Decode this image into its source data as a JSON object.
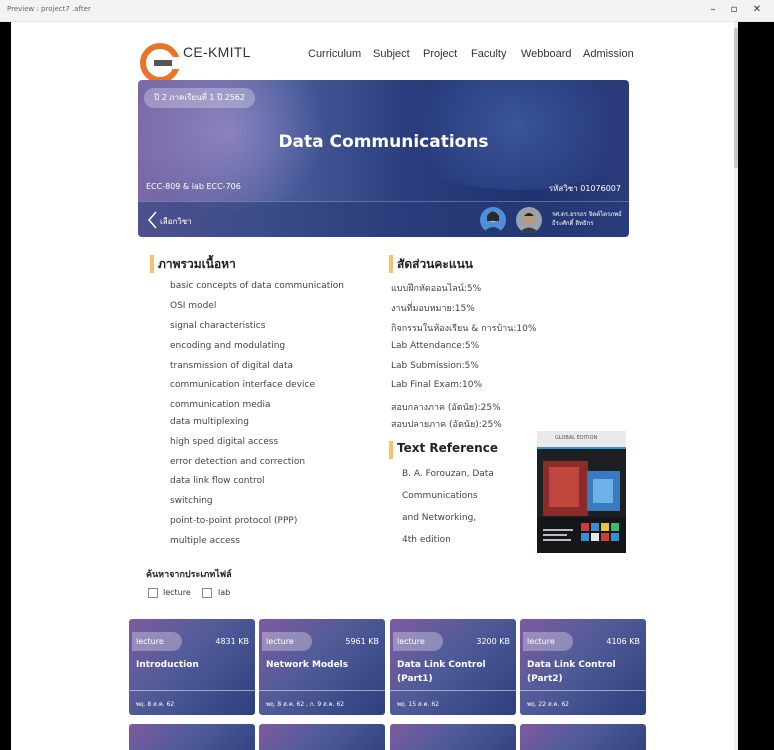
{
  "window": {
    "title": "Preview : project7 .after"
  },
  "nav": {
    "brand": "CE-KMITL",
    "links": [
      "Curriculum",
      "Subject",
      "Project",
      "Faculty",
      "Webboard",
      "Admission"
    ]
  },
  "banner": {
    "term": "ปี 2 ภาคเรียนที่ 1 ปี 2562",
    "title": "Data Communications",
    "course_codes": "ECC-809 & lab ECC-706",
    "subject_code": "รหัสวิชา 01076007",
    "back_label": "เลือกวิชา",
    "teachers": [
      "รศ.ดร.อรรถร จิตต์ไตรภพธ์",
      "ธีระศักดิ์ สิทธิกร"
    ]
  },
  "overview": {
    "heading": "ภาพรวมเนื้อหา",
    "items": [
      "basic concepts of data communication",
      "OSI model",
      "signal characteristics",
      "encoding and modulating",
      "transmission of digital data",
      "communication interface device",
      "communication media",
      "data multiplexing",
      "high sped digital access",
      "error detection and correction",
      "data link flow control",
      "switching",
      "point-to-point protocol (PPP)",
      "multiple access"
    ]
  },
  "grading": {
    "heading": "สัดส่วนคะแนน",
    "items": [
      "แบบฝึกหัดออนไลน์:5%",
      "งานที่มอบหมาย:15%",
      "กิจกรรมในห้องเรียน & การบ้าน:10%",
      "Lab Attendance:5%",
      "Lab Submission:5%",
      "Lab Final Exam:10%",
      "สอบกลางภาค (อัตนัย):25%",
      "สอบปลายภาค (อัตนัย):25%"
    ]
  },
  "reference": {
    "heading": "Text Reference",
    "lines": [
      "B. A. Forouzan, Data",
      "Communications",
      "and Networking,",
      "4th edition"
    ],
    "book_edition": "GLOBAL EDITION"
  },
  "filter": {
    "heading": "ค้นหาจากประเภทไฟล์",
    "options": [
      "lecture",
      "lab"
    ]
  },
  "cards": [
    {
      "tag": "lecture",
      "size": "4831 KB",
      "title": "Introduction",
      "date": "พฤ. 8 ส.ค. 62"
    },
    {
      "tag": "lecture",
      "size": "5961 KB",
      "title": "Network Models",
      "date": "พฤ. 8 ส.ค. 62 , ก. 9 ส.ค. 62"
    },
    {
      "tag": "lecture",
      "size": "3200 KB",
      "title": "Data Link Control (Part1)",
      "date": "พฤ. 15 ส.ค. 62"
    },
    {
      "tag": "lecture",
      "size": "4106 KB",
      "title": "Data Link Control (Part2)",
      "date": "พฤ. 22 ส.ค. 62"
    }
  ]
}
